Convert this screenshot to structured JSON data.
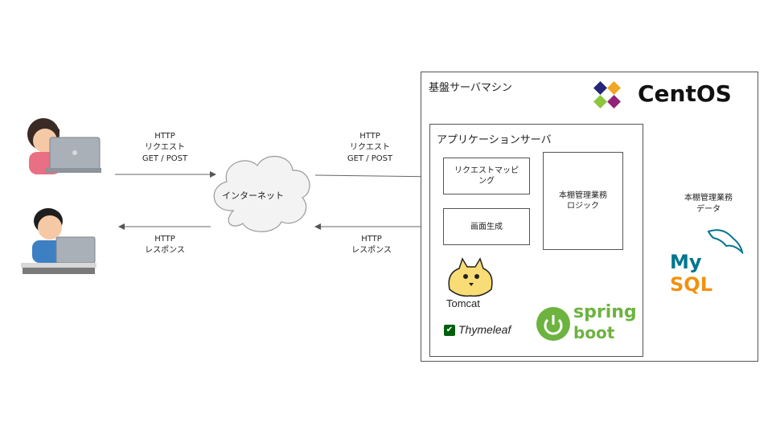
{
  "arrows": {
    "request_left": "HTTP\nリクエスト\nGET / POST",
    "request_right": "HTTP\nリクエスト\nGET / POST",
    "response_left": "HTTP\nレスポンス",
    "response_right": "HTTP\nレスポンス"
  },
  "internet": {
    "label": "インターネット"
  },
  "server": {
    "title": "基盤サーバマシン",
    "os_logo": "CentOS",
    "app_server": {
      "title": "アプリケーションサーバ",
      "request_mapping": "リクエストマッピング",
      "screen_generation": "画面生成",
      "business_logic": "本棚管理業務\nロジック",
      "tomcat_label": "Tomcat",
      "thymeleaf_label": "Thymeleaf",
      "spring_label": "spring",
      "boot_label": "boot"
    },
    "database": {
      "label": "本棚管理業務\nデータ",
      "logo": "MySQL"
    }
  },
  "colors": {
    "centos_purple": "#932279",
    "centos_green": "#8cc63f",
    "centos_orange": "#efa724",
    "centos_blue": "#262577",
    "mysql_blue": "#00758f",
    "mysql_orange": "#f29111",
    "spring_green": "#6db33f",
    "thymeleaf_green": "#005f0f"
  }
}
